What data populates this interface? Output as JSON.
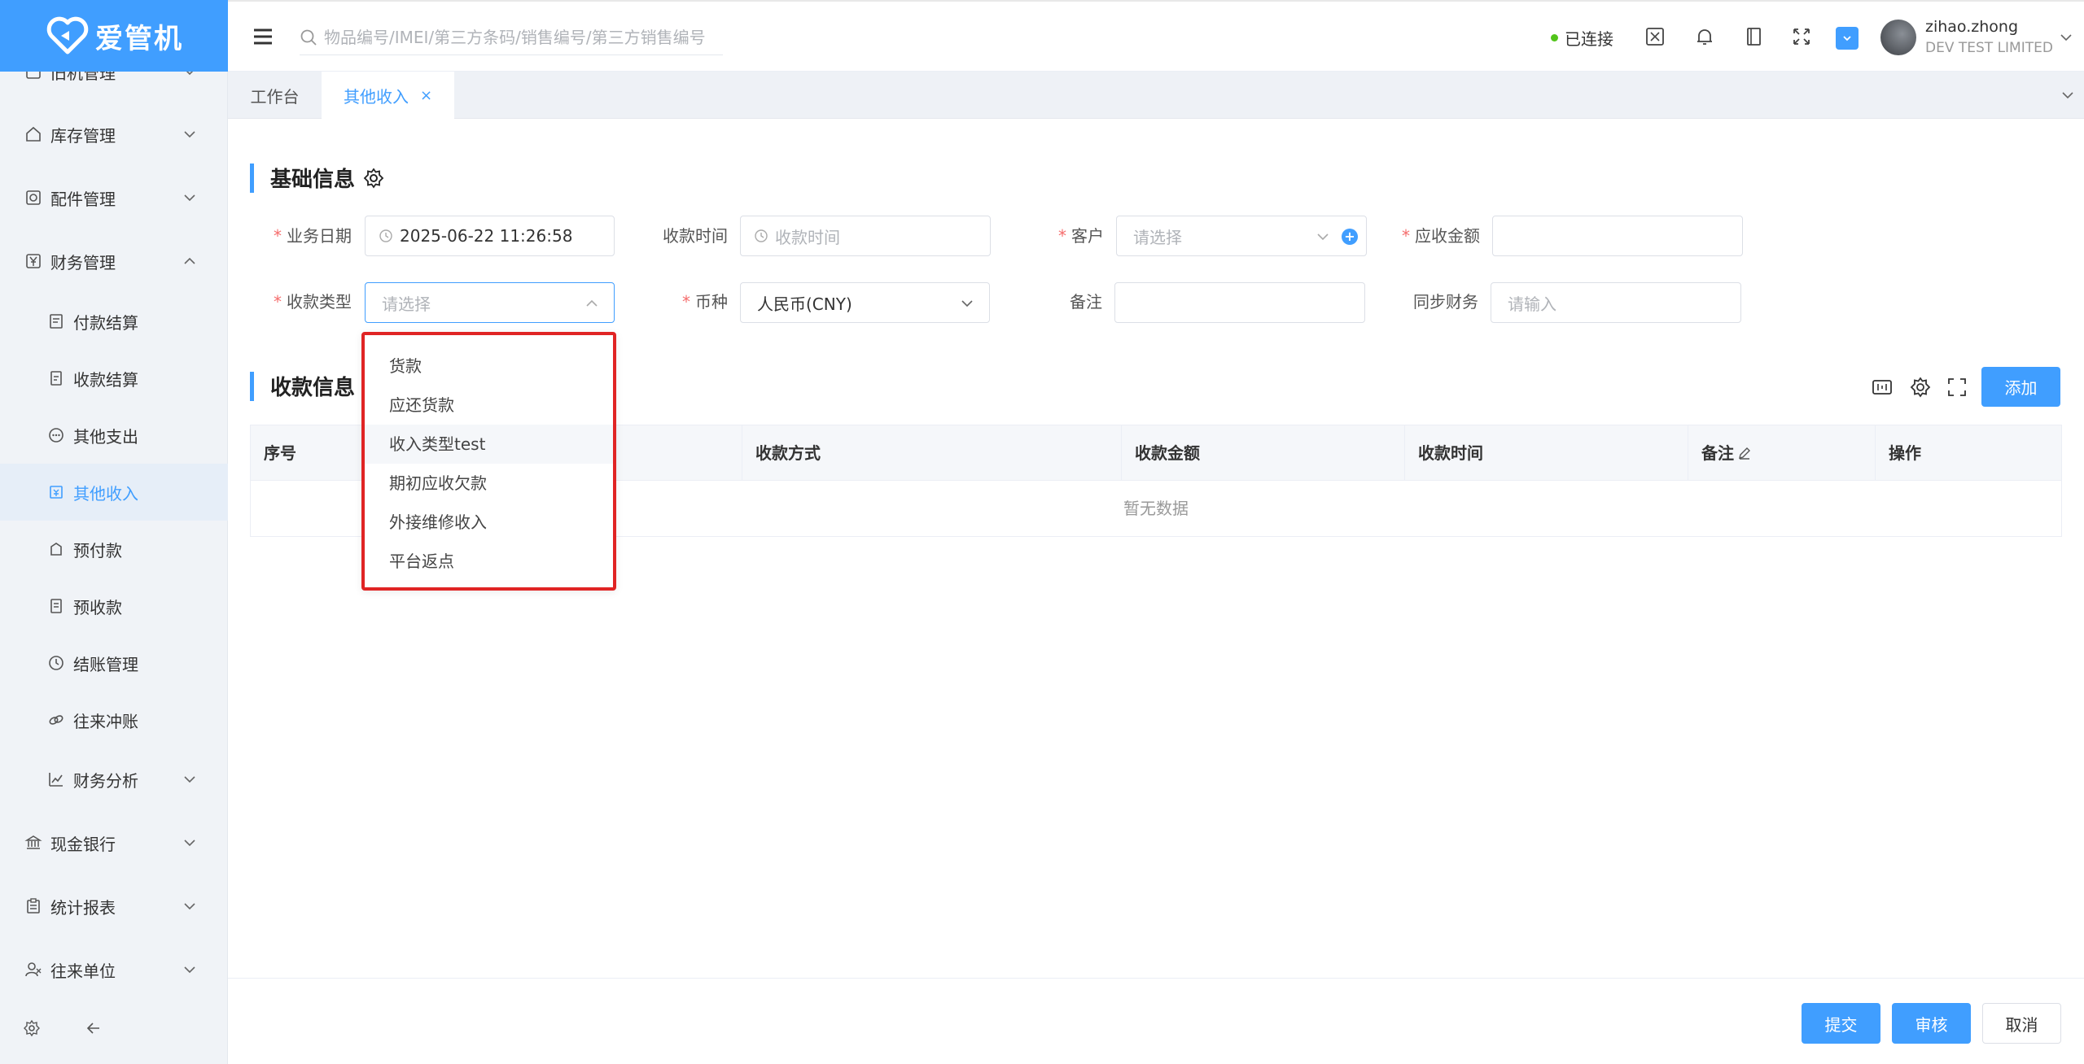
{
  "app": {
    "logo_text": "爱管机"
  },
  "sidebar": {
    "items": [
      {
        "label": "库存管理",
        "icon": "home-icon"
      },
      {
        "label": "配件管理",
        "icon": "parts-icon"
      },
      {
        "label": "财务管理",
        "icon": "yen-icon"
      },
      {
        "label": "付款结算",
        "icon": "payment-icon"
      },
      {
        "label": "收款结算",
        "icon": "receipt-icon"
      },
      {
        "label": "其他支出",
        "icon": "dots-circle-icon"
      },
      {
        "label": "其他收入",
        "icon": "income-icon"
      },
      {
        "label": "预付款",
        "icon": "prepay-icon"
      },
      {
        "label": "预收款",
        "icon": "doc-icon"
      },
      {
        "label": "结账管理",
        "icon": "history-icon"
      },
      {
        "label": "往来冲账",
        "icon": "link-icon"
      },
      {
        "label": "财务分析",
        "icon": "chart-icon"
      },
      {
        "label": "现金银行",
        "icon": "bank-icon"
      },
      {
        "label": "统计报表",
        "icon": "report-icon"
      },
      {
        "label": "往来单位",
        "icon": "user-group-icon"
      }
    ],
    "clipped_label": "旧机管理"
  },
  "header": {
    "search_placeholder": "物品编号/IMEI/第三方条码/销售编号/第三方销售编号",
    "status": "已连接",
    "user_name": "zihao.zhong",
    "company": "DEV TEST LIMITED"
  },
  "tabs": [
    {
      "label": "工作台"
    },
    {
      "label": "其他收入",
      "close": "×"
    }
  ],
  "basic_info": {
    "title": "基础信息",
    "fields": {
      "biz_date_label": "业务日期",
      "biz_date_value": "2025-06-22 11:26:58",
      "receive_time_label": "收款时间",
      "receive_time_placeholder": "收款时间",
      "customer_label": "客户",
      "customer_placeholder": "请选择",
      "amount_due_label": "应收金额",
      "receive_type_label": "收款类型",
      "receive_type_placeholder": "请选择",
      "currency_label": "币种",
      "currency_value": "人民币(CNY)",
      "remark_label": "备注",
      "sync_label": "同步财务",
      "sync_placeholder": "请输入"
    }
  },
  "dropdown": {
    "options": [
      "货款",
      "应还货款",
      "收入类型test",
      "期初应收欠款",
      "外接维修收入",
      "平台返点"
    ]
  },
  "receipt_info": {
    "title": "收款信息",
    "add_label": "添加",
    "columns": [
      "序号",
      "收款方式",
      "收款金额",
      "收款时间",
      "备注",
      "操作"
    ],
    "empty_text": "暂无数据"
  },
  "footer": {
    "submit": "提交",
    "audit": "审核",
    "cancel": "取消"
  },
  "colors": {
    "primary": "#409eff",
    "highlight": "#e02424",
    "status_ok": "#52c41a"
  }
}
